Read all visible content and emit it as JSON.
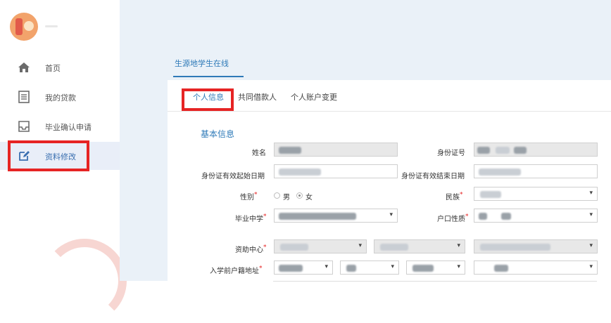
{
  "sidebar": {
    "items": [
      {
        "label": "首页",
        "icon": "home-icon"
      },
      {
        "label": "我的贷款",
        "icon": "document-list-icon"
      },
      {
        "label": "毕业确认申请",
        "icon": "inbox-icon"
      },
      {
        "label": "资料修改",
        "icon": "edit-icon",
        "active": true
      }
    ]
  },
  "top_tab": {
    "label": "生源地学生在线"
  },
  "subtabs": [
    "个人信息",
    "共同借款人",
    "个人账户变更"
  ],
  "section_title": "基本信息",
  "form": {
    "name_label": "姓名",
    "id_label": "身份证号",
    "id_start_label": "身份证有效起始日期",
    "id_end_label": "身份证有效结束日期",
    "gender_label": "性别",
    "gender_options": [
      "男",
      "女"
    ],
    "gender_selected": "女",
    "ethnicity_label": "民族",
    "school_label": "毕业中学",
    "hukou_type_label": "户口性质",
    "aid_center_label": "资助中心",
    "prior_address_label": "入学前户籍地址",
    "required_mark": "*",
    "caret": "▾"
  },
  "colors": {
    "accent": "#2e7ab8",
    "highlight": "#e62424",
    "active_bg": "#e9eef8"
  }
}
